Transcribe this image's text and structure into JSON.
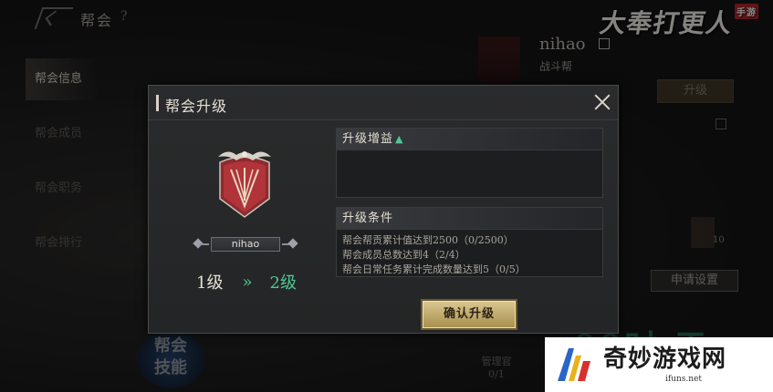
{
  "background": {
    "top_title": "帮会",
    "help_glyph": "?",
    "logo_text": "大奉打更人",
    "logo_seal": "手游",
    "sidebar_items": [
      "帮会信息",
      "帮会成员",
      "帮会职务",
      "帮会排行"
    ],
    "guild_skill": "帮会\n技能",
    "guild_name": "nihao",
    "guild_type": "战斗帮",
    "upgrade_button": "升级",
    "apply_settings_button": "申请设置",
    "member_count_suffix": "10",
    "manager_label": "管理官",
    "manager_count": "0/1",
    "faded_promo_text": "00时 于"
  },
  "modal": {
    "title": "帮会升级",
    "guild_name": "nihao",
    "current_level": "1级",
    "arrow": "»",
    "next_level": "2级",
    "benefit_header": "升级增益",
    "condition_header": "升级条件",
    "conditions": [
      "帮会帮贡累计值达到2500（0/2500）",
      "帮会成员总数达到4（2/4）",
      "帮会日常任务累计完成数量达到5（0/5）"
    ],
    "confirm_button": "确认升级"
  },
  "watermark": {
    "title": "奇妙游戏网",
    "url": "ifuns.net"
  },
  "colors": {
    "accent_green": "#4ec995",
    "gold_button": "#c9b57a",
    "banner_red": "#b0343a"
  },
  "icons": [
    "back-arrow-icon",
    "help-icon",
    "close-icon",
    "guild-emblem-icon",
    "up-arrow-icon",
    "edit-icon"
  ]
}
